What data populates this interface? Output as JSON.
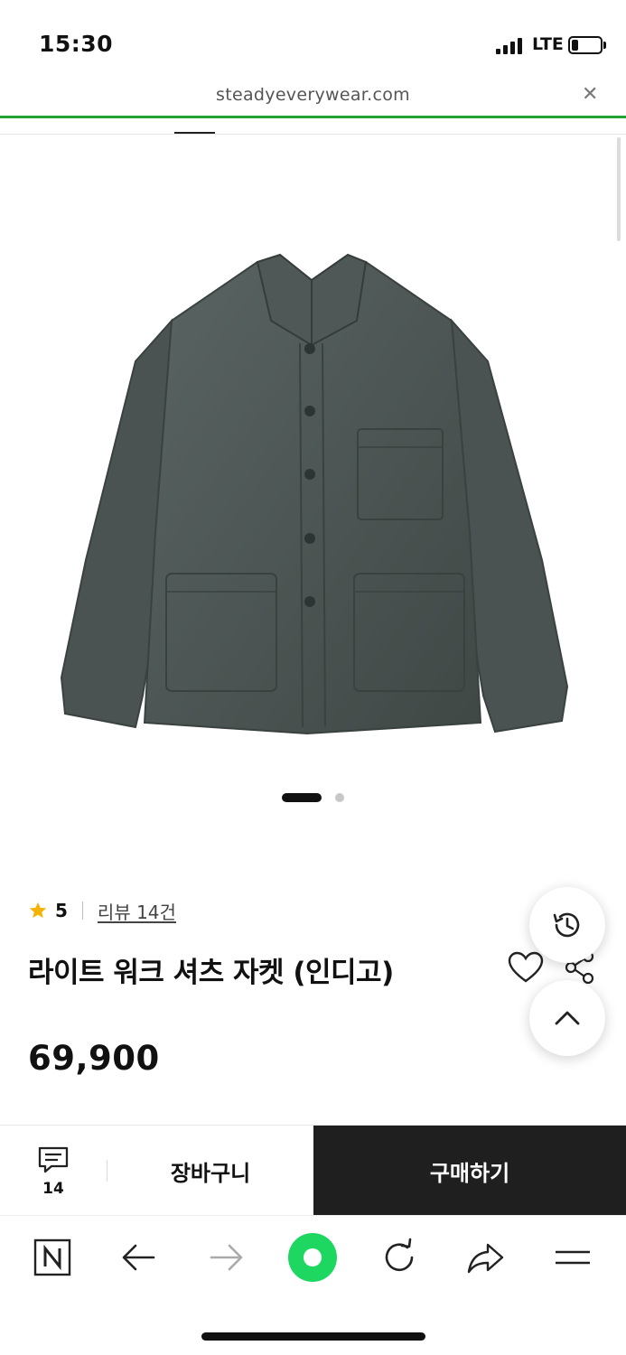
{
  "status_bar": {
    "time": "15:30",
    "network": "LTE"
  },
  "browser": {
    "url": "steadyeverywear.com"
  },
  "product": {
    "rating": "5",
    "review_link": "리뷰 14건",
    "title": "라이트 워크 셔츠 자켓 (인디고)",
    "price": "69,900",
    "image_icon": "jacket-image",
    "image_color": "#4b5452"
  },
  "carousel": {
    "total": 2,
    "active": 1
  },
  "purchase_bar": {
    "review_count": "14",
    "cart_label": "장바구니",
    "buy_label": "구매하기",
    "buy_bg": "#1f1f1f"
  },
  "colors": {
    "accent_loading": "#21a336",
    "star": "#f5b400",
    "home_button": "#1ed760"
  }
}
